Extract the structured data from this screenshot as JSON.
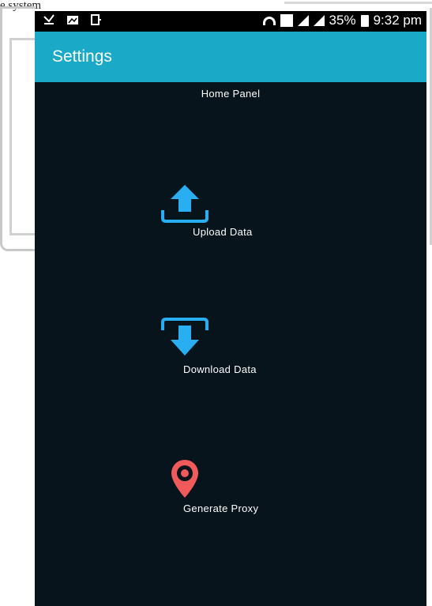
{
  "document": {
    "caption": "e system"
  },
  "statusbar": {
    "battery": "35%",
    "time": "9:32 pm"
  },
  "appbar": {
    "title": "Settings"
  },
  "panel": {
    "title": "Home Panel"
  },
  "items": [
    {
      "label": "Upload Data",
      "icon": "upload-icon",
      "color": "#29aef2"
    },
    {
      "label": "Download Data",
      "icon": "download-icon",
      "color": "#29aef2"
    },
    {
      "label": "Generate Proxy",
      "icon": "location-pin-icon",
      "color": "#f05a5a"
    }
  ],
  "colors": {
    "appbar": "#1ba9c8",
    "background": "#07141b"
  }
}
